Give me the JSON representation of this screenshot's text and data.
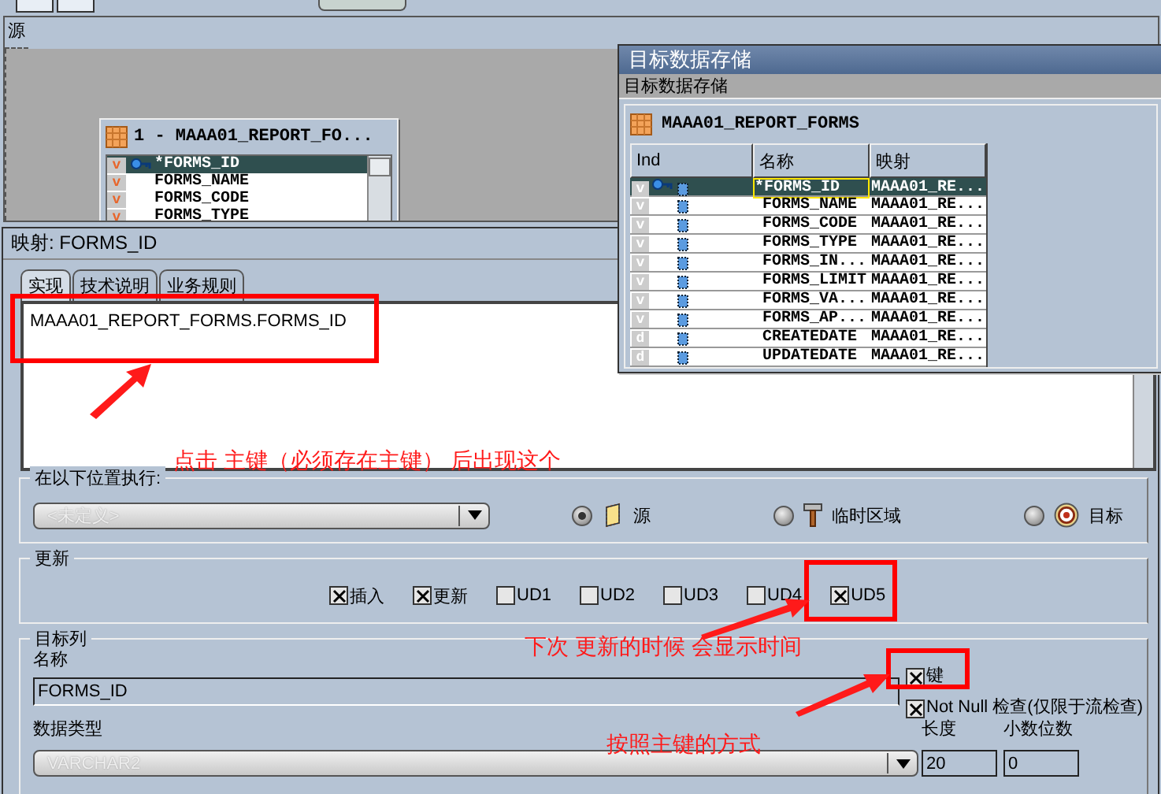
{
  "source_panel": {
    "label": "源",
    "datastore": {
      "title": "1 - MAAA01_REPORT_FO...",
      "columns": [
        {
          "ind": "v",
          "name": "*FORMS_ID",
          "key": true,
          "selected": true
        },
        {
          "ind": "v",
          "name": "FORMS_NAME",
          "key": false,
          "selected": false
        },
        {
          "ind": "v",
          "name": "FORMS_CODE",
          "key": false,
          "selected": false
        },
        {
          "ind": "v",
          "name": "FORMS_TYPE",
          "key": false,
          "selected": false
        }
      ]
    }
  },
  "target_window": {
    "title": "目标数据存储",
    "subtitle": "目标数据存储",
    "datastore": "MAAA01_REPORT_FORMS",
    "columns": [
      "Ind",
      "名称",
      "映射"
    ],
    "rows": [
      {
        "ind": "v",
        "key": true,
        "selected": true,
        "name": "*FORMS_ID",
        "mapping": "MAAA01_RE..."
      },
      {
        "ind": "v",
        "key": false,
        "selected": false,
        "name": "FORMS_NAME",
        "mapping": "MAAA01_RE..."
      },
      {
        "ind": "v",
        "key": false,
        "selected": false,
        "name": "FORMS_CODE",
        "mapping": "MAAA01_RE..."
      },
      {
        "ind": "v",
        "key": false,
        "selected": false,
        "name": "FORMS_TYPE",
        "mapping": "MAAA01_RE..."
      },
      {
        "ind": "v",
        "key": false,
        "selected": false,
        "name": "FORMS_IN...",
        "mapping": "MAAA01_RE..."
      },
      {
        "ind": "v",
        "key": false,
        "selected": false,
        "name": "FORMS_LIMIT",
        "mapping": "MAAA01_RE..."
      },
      {
        "ind": "v",
        "key": false,
        "selected": false,
        "name": "FORMS_VA...",
        "mapping": "MAAA01_RE..."
      },
      {
        "ind": "v",
        "key": false,
        "selected": false,
        "name": "FORMS_AP...",
        "mapping": "MAAA01_RE..."
      },
      {
        "ind": "d",
        "key": false,
        "selected": false,
        "name": "CREATEDATE",
        "mapping": "MAAA01_RE..."
      },
      {
        "ind": "d",
        "key": false,
        "selected": false,
        "name": "UPDATEDATE",
        "mapping": "MAAA01_RE..."
      }
    ]
  },
  "mapping_panel": {
    "title": "映射: FORMS_ID",
    "tabs": [
      {
        "label": "实现",
        "selected": true
      },
      {
        "label": "技术说明",
        "selected": false
      },
      {
        "label": "业务规则",
        "selected": false
      }
    ],
    "implementation": "MAAA01_REPORT_FORMS.FORMS_ID",
    "execute_on": {
      "label": "在以下位置执行:",
      "dropdown": {
        "value": "<未定义>",
        "disabled": true
      },
      "options": [
        {
          "label": "源",
          "kind": "datastore",
          "selected": true
        },
        {
          "label": "临时区域",
          "kind": "hammer",
          "selected": false
        },
        {
          "label": "目标",
          "kind": "target",
          "selected": false
        }
      ]
    },
    "update": {
      "label": "更新",
      "checkboxes": [
        {
          "label": "插入",
          "checked": true
        },
        {
          "label": "更新",
          "checked": true
        },
        {
          "label": "UD1",
          "checked": false
        },
        {
          "label": "UD2",
          "checked": false
        },
        {
          "label": "UD3",
          "checked": false
        },
        {
          "label": "UD4",
          "checked": false
        },
        {
          "label": "UD5",
          "checked": true
        }
      ]
    },
    "target_column": {
      "label": "目标列",
      "name_label": "名称",
      "name": "FORMS_ID",
      "key": {
        "label": "键",
        "checked": true
      },
      "not_null": {
        "label": "Not Null 检查(仅限于流检查)",
        "checked": true
      },
      "datatype_label": "数据类型",
      "datatype": {
        "value": "VARCHAR2",
        "disabled": true
      },
      "length_label": "长度",
      "length": "20",
      "scale_label": "小数位数",
      "scale": "0"
    }
  },
  "annotations": [
    {
      "text": "点击 主键（必须存在主键） 后出现这个"
    },
    {
      "text": "下次 更新的时候 会显示时间"
    },
    {
      "text": "按照主键的方式"
    }
  ]
}
